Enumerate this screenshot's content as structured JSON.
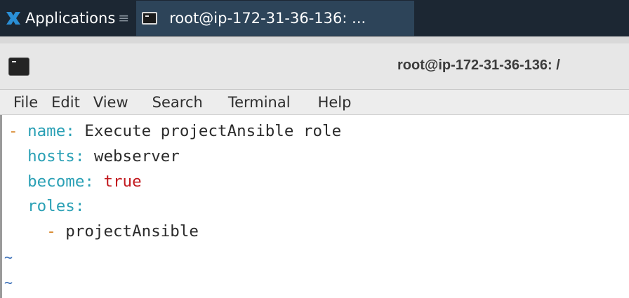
{
  "panel": {
    "applications_label": "Applications",
    "menu_glyph": "≡",
    "taskbar_window_title": "root@ip-172-31-36-136: ...",
    "xfce_logo_color": "#2a8fd6"
  },
  "window": {
    "title": "root@ip-172-31-36-136: /"
  },
  "menubar": {
    "items": [
      "File",
      "Edit",
      "View",
      "Search",
      "Terminal",
      "Help"
    ]
  },
  "editor": {
    "lines": [
      {
        "dash": "-",
        "key": "name:",
        "value": " Execute projectAnsible role"
      },
      {
        "key": "hosts:",
        "value": " webserver"
      },
      {
        "key": "become:",
        "bool": " true"
      },
      {
        "key": "roles:"
      },
      {
        "dash": "-",
        "value": " projectAnsible"
      }
    ],
    "tilde": "~",
    "colors": {
      "dash": "#d7872b",
      "key": "#2aa0b5",
      "bool": "#c2181d",
      "tilde": "#3a6fb8"
    }
  }
}
